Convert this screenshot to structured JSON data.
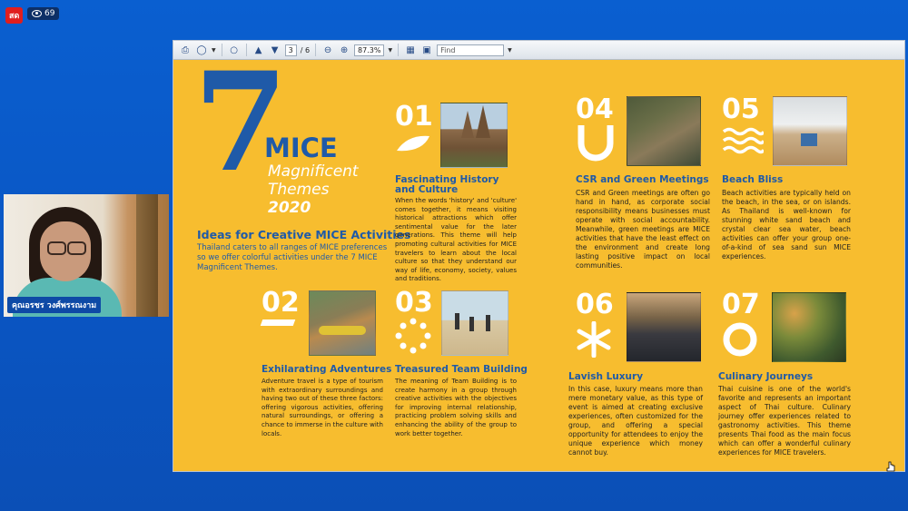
{
  "stream": {
    "live_label": "สด",
    "viewer_count": "69"
  },
  "webcam": {
    "name": "คุณอรชร วงศ์พรรณงาม"
  },
  "toolbar": {
    "page_current": "3",
    "page_total": "/ 6",
    "zoom": "87.3%",
    "find_placeholder": "Find"
  },
  "page": {
    "title_number": "7",
    "title_mice": "MICE",
    "title_magnificent": "Magnificent",
    "title_themes": "Themes",
    "title_year": "2020",
    "ideas_heading": "Ideas for Creative MICE Activities",
    "subtitle": "Thailand caters to all ranges of MICE preferences so we offer colorful activities under the 7 MICE Magnificent Themes.",
    "themes": [
      {
        "number": "01",
        "title": "Fascinating History and Culture",
        "body": "When the words 'history' and 'culture' comes together, it means visiting historical attractions which offer sentimental value for the later generations. This theme will help promoting cultural activities for MICE travelers to learn about the local culture so that they understand our way of life, economy, society, values and traditions."
      },
      {
        "number": "02",
        "title": "Exhilarating Adventures",
        "body": "Adventure travel is a type of tourism with extraordinary surroundings and having two out of these three factors: offering vigorous activities, offering natural surroundings, or offering a chance to immerse in the culture with locals."
      },
      {
        "number": "03",
        "title": "Treasured Team Building",
        "body": "The meaning of Team Building is to create harmony in a group through creative activities with the objectives for improving internal relationship, practicing problem solving skills and enhancing the ability of the group to work better together."
      },
      {
        "number": "04",
        "title": "CSR and Green Meetings",
        "body": "CSR and Green meetings are often go hand in hand, as corporate social responsibility means businesses must operate with social accountability. Meanwhile, green meetings are MICE activities that have the least effect on the environment and create long lasting positive impact on local communities."
      },
      {
        "number": "05",
        "title": "Beach Bliss",
        "body": "Beach activities are typically held on the beach, in the sea, or on islands. As Thailand is well-known for stunning white sand beach and crystal clear sea water, beach activities can offer your group one-of-a-kind of sea sand sun MICE experiences."
      },
      {
        "number": "06",
        "title": "Lavish Luxury",
        "body": "In this case, luxury means more than mere monetary value, as this type of event is aimed at creating exclusive experiences, often customized for the group, and offering a special opportunity for attendees to enjoy the unique experience which money cannot buy."
      },
      {
        "number": "07",
        "title": "Culinary Journeys",
        "body": "Thai cuisine is one of the world's favorite and represents an important aspect of Thai culture. Culinary journey offer experiences related to gastronomy activities. This theme presents Thai food as the main focus which can offer a wonderful culinary experiences for MICE travelers."
      }
    ]
  }
}
